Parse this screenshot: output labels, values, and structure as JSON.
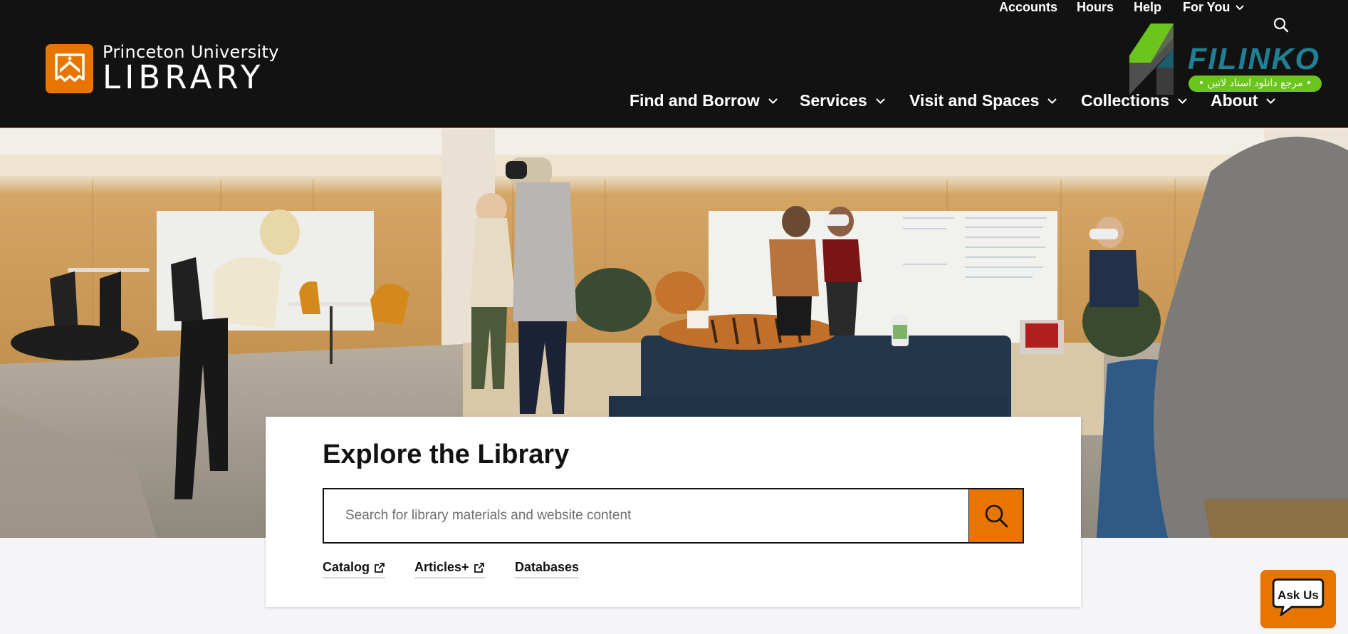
{
  "brand": {
    "line1": "Princeton University",
    "line2": "LIBRARY",
    "color": "#e77500",
    "header_bg": "#121212"
  },
  "utility_nav": {
    "accounts": "Accounts",
    "hours": "Hours",
    "help": "Help",
    "for_you": "For You"
  },
  "main_nav": {
    "find_borrow": "Find and Borrow",
    "services": "Services",
    "visit_spaces": "Visit and Spaces",
    "collections": "Collections",
    "about": "About"
  },
  "watermark": {
    "name": "FILINKO",
    "tagline": "• مرجع دانلود اسناد لاتین •"
  },
  "search": {
    "title": "Explore the Library",
    "placeholder": "Search for library materials and website content"
  },
  "quick_links": {
    "catalog": "Catalog",
    "articles": "Articles+",
    "databases": "Databases"
  },
  "chat": {
    "label": "Ask Us"
  }
}
